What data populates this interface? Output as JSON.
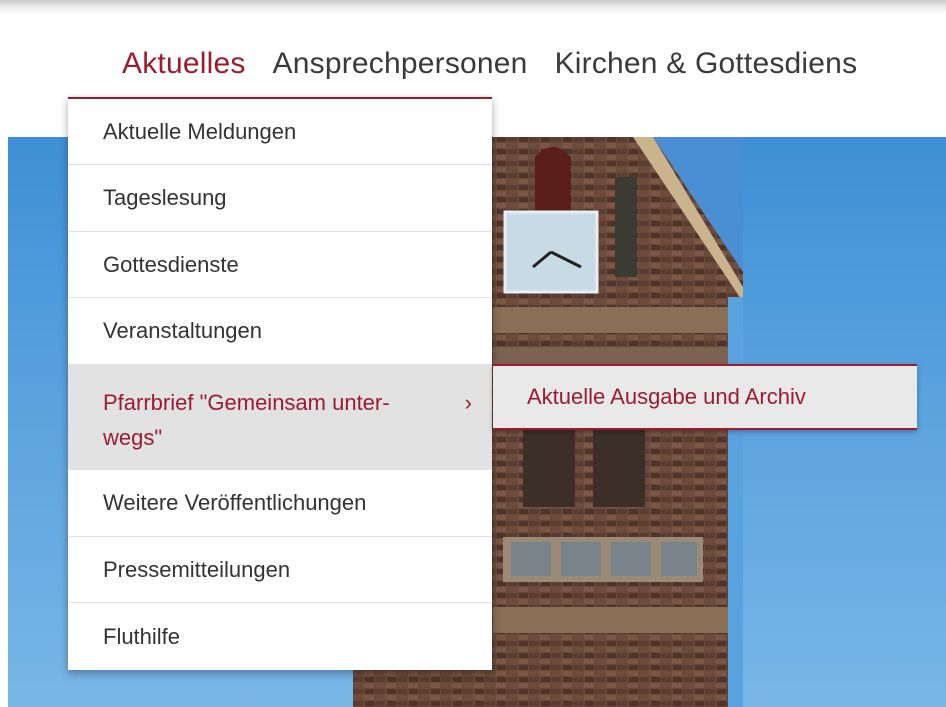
{
  "topnav": {
    "items": [
      {
        "label": "Aktuelles",
        "active": true
      },
      {
        "label": "Ansprechpersonen",
        "active": false
      },
      {
        "label": "Kirchen & Gottesdiens",
        "active": false
      }
    ]
  },
  "dropdown": {
    "items": [
      {
        "label": "Aktuelle Meldungen"
      },
      {
        "label": "Tageslesung"
      },
      {
        "label": "Gottesdienste"
      },
      {
        "label": "Veranstaltungen"
      },
      {
        "label": "Pfarrbrief \"Gemeinsam unter-wegs\"",
        "has_submenu": true,
        "chevron": "›"
      },
      {
        "label": "Weitere Veröffentlichungen"
      },
      {
        "label": "Pressemitteilungen"
      },
      {
        "label": "Fluthilfe"
      }
    ]
  },
  "submenu": {
    "items": [
      {
        "label": "Aktuelle Ausgabe und Archiv"
      }
    ]
  },
  "colors": {
    "accent": "#9b1c2e",
    "text": "#333333",
    "active_bg": "#e2e2e2",
    "sky": "#5aa2de"
  },
  "hero": {
    "icon": "church-tower-image"
  }
}
